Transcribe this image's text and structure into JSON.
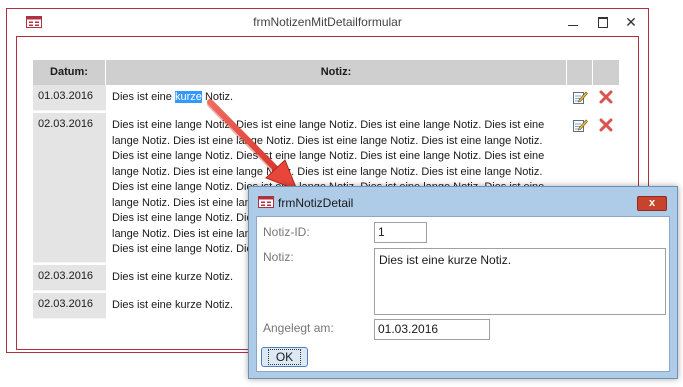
{
  "main_window": {
    "title": "frmNotizenMitDetailformular",
    "controls": {
      "minimize": "—",
      "maximize": "□",
      "close": "✕"
    }
  },
  "table": {
    "headers": {
      "date": "Datum:",
      "note": "Notiz:"
    },
    "rows": [
      {
        "date": "01.03.2016",
        "note_before": "Dies ist eine ",
        "note_selected": "kurze",
        "note_after": " Notiz."
      },
      {
        "date": "02.03.2016",
        "note": "Dies ist eine lange Notiz. Dies ist eine lange Notiz. Dies ist eine lange Notiz. Dies ist eine lange Notiz. Dies ist eine lange Notiz. Dies ist eine lange Notiz. Dies ist eine lange Notiz. Dies ist eine lange Notiz. Dies ist eine lange Notiz. Dies ist eine lange Notiz. Dies ist eine lange Notiz. Dies ist eine lange Notiz. Dies ist eine lange Notiz. Dies ist eine lange Notiz. Dies ist eine lange Notiz. Dies ist eine lange Notiz. Dies ist eine lange Notiz. Dies ist eine lange Notiz. Dies ist eine lange Notiz. Dies ist eine lange Notiz. Dies ist eine lange Notiz. Dies ist eine lange Notiz. Dies ist eine lange Notiz. Dies ist eine lange Notiz. Dies ist eine lange Notiz. Dies ist eine lange Notiz. Dies ist eine lange Notiz. Dies ist eine lange Notiz. Dies ist eine lange Notiz. Dies ist eine lange Notiz."
      },
      {
        "date": "02.03.2016",
        "note": "Dies ist eine kurze Notiz."
      },
      {
        "date": "02.03.2016",
        "note": "Dies ist eine kurze Notiz."
      }
    ],
    "icons": {
      "edit": "edit-icon",
      "delete": "delete-icon"
    }
  },
  "detail_dialog": {
    "title": "frmNotizDetail",
    "close": "x",
    "fields": {
      "id_label": "Notiz-ID:",
      "id_value": "1",
      "note_label": "Notiz:",
      "note_value": "Dies ist eine kurze Notiz.",
      "created_label": "Angelegt am:",
      "created_value": "01.03.2016"
    },
    "ok_label": "OK"
  },
  "colors": {
    "window_border": "#b03040",
    "header_bg": "#cfcfcf",
    "date_bg": "#e4e4e4",
    "selection": "#3399ff",
    "arrow": "#e8463a",
    "dialog_frame": "#aecbe8",
    "close_button": "#c7432e"
  }
}
